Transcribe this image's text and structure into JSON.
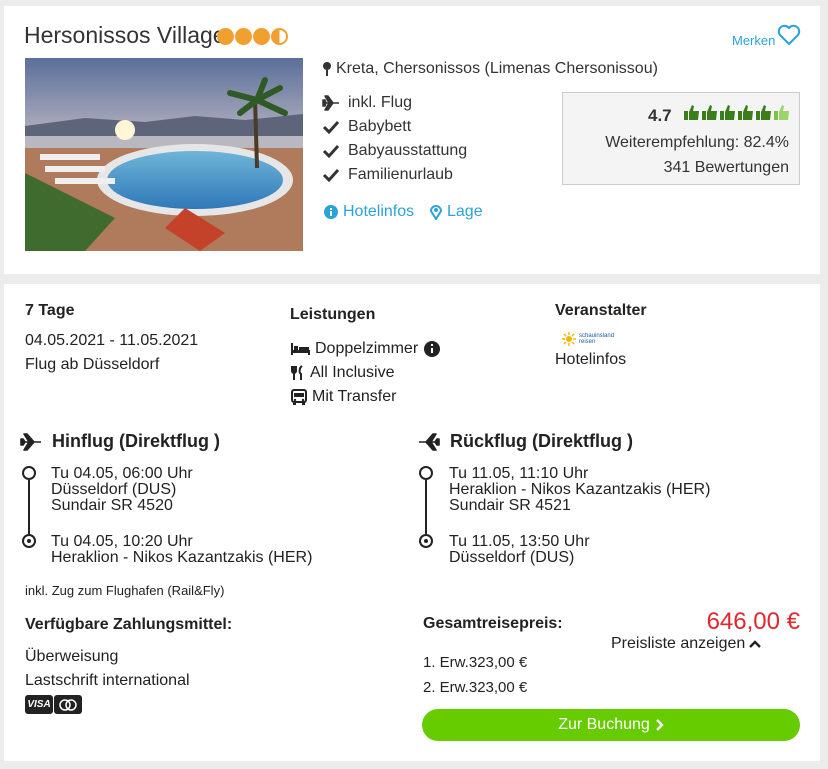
{
  "hotel": {
    "name": "Hersonissos Village",
    "stars": 3.5,
    "location": "Kreta, Chersonissos (Limenas Chersonissou)",
    "features": [
      "inkl. Flug",
      "Babybett",
      "Babyausstattung",
      "Familienurlaub"
    ],
    "links": {
      "hotelinfos": "Hotelinfos",
      "lage": "Lage"
    },
    "merken": "Merken"
  },
  "rating": {
    "score": "4.7",
    "thumbs": 5.5,
    "recommendation": "Weiterempfehlung: 82.4%",
    "reviews": "341 Bewertungen"
  },
  "trip": {
    "duration": "7 Tage",
    "dates": "04.05.2021 - 11.05.2021",
    "departure": "Flug ab Düsseldorf"
  },
  "services": {
    "title": "Leistungen",
    "items": [
      "Doppelzimmer",
      "All Inclusive",
      "Mit Transfer"
    ]
  },
  "operator": {
    "title": "Veranstalter",
    "logo_text_1": "schauinsland",
    "logo_text_2": "reisen",
    "link": "Hotelinfos"
  },
  "outbound": {
    "title": "Hinflug (Direktflug )",
    "dep_time": "Tu 04.05, 06:00 Uhr",
    "dep_airport": "Düsseldorf (DUS)",
    "flight": "Sundair SR 4520",
    "arr_time": "Tu 04.05, 10:20 Uhr",
    "arr_airport": "Heraklion - Nikos Kazantzakis (HER)"
  },
  "inbound": {
    "title": "Rückflug (Direktflug )",
    "dep_time": "Tu 11.05, 11:10 Uhr",
    "dep_airport": "Heraklion - Nikos Kazantzakis (HER)",
    "flight": "Sundair SR 4521",
    "arr_time": "Tu 11.05, 13:50 Uhr",
    "arr_airport": "Düsseldorf (DUS)"
  },
  "rail_note": "inkl. Zug zum Flughafen (Rail&Fly)",
  "payment": {
    "title": "Verfügbare Zahlungsmittel:",
    "methods": [
      "Überweisung",
      "Lastschrift international"
    ],
    "card_labels": [
      "VISA",
      "MC"
    ]
  },
  "pricing": {
    "label": "Gesamtreisepreis:",
    "total": "646,00 €",
    "list_toggle": "Preisliste anzeigen",
    "lines": [
      "1. Erw.323,00 €",
      "2. Erw.323,00 €"
    ],
    "book_button": "Zur Buchung"
  },
  "colors": {
    "link": "#2aa3d8",
    "price": "#e3262e",
    "button": "#66cc00",
    "star": "#f0a030",
    "thumb": "#3a7d1a"
  }
}
